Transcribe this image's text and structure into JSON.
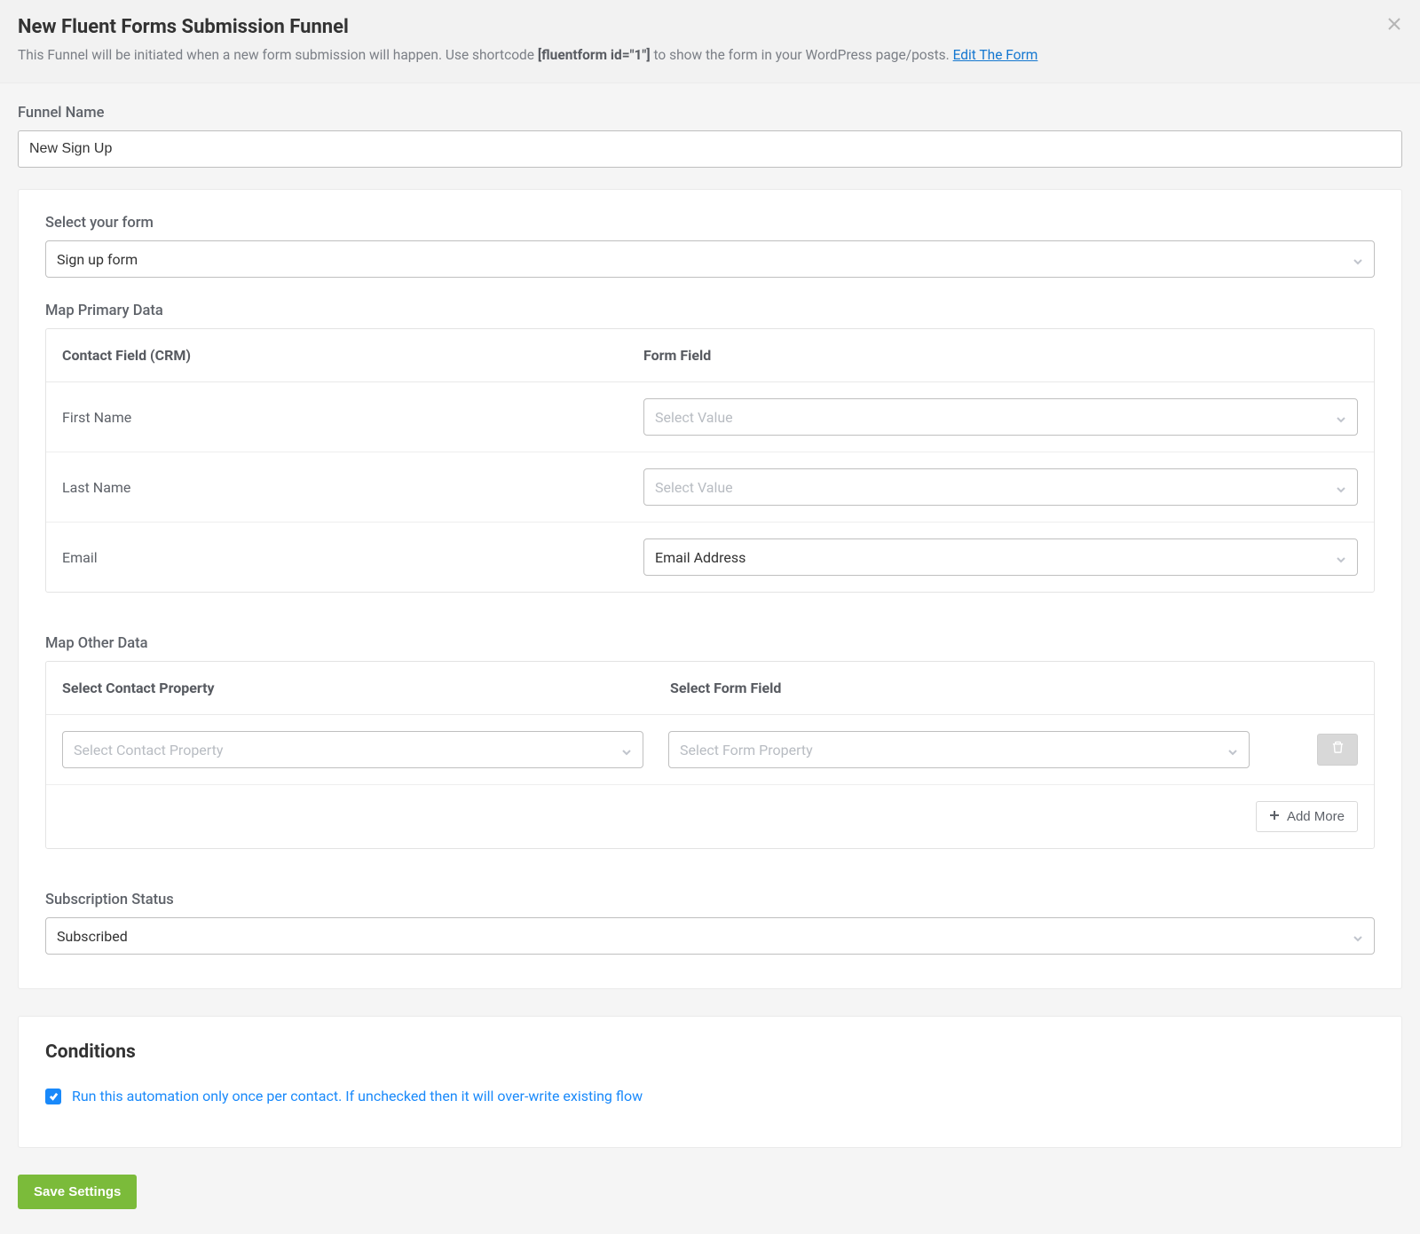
{
  "header": {
    "title": "New Fluent Forms Submission Funnel",
    "description_prefix": "This Funnel will be initiated when a new form submission will happen. Use shortcode ",
    "shortcode": "[fluentform id=\"1\"]",
    "description_suffix": " to show the form in your WordPress page/posts. ",
    "edit_link": "Edit The Form"
  },
  "funnel_name": {
    "label": "Funnel Name",
    "value": "New Sign Up"
  },
  "select_form": {
    "label": "Select your form",
    "value": "Sign up form"
  },
  "map_primary": {
    "label": "Map Primary Data",
    "col1": "Contact Field (CRM)",
    "col2": "Form Field",
    "rows": [
      {
        "crm": "First Name",
        "form_value": "",
        "placeholder": "Select Value"
      },
      {
        "crm": "Last Name",
        "form_value": "",
        "placeholder": "Select Value"
      },
      {
        "crm": "Email",
        "form_value": "Email Address",
        "placeholder": "Select Value"
      }
    ]
  },
  "map_other": {
    "label": "Map Other Data",
    "col1": "Select Contact Property",
    "col2": "Select Form Field",
    "rows": [
      {
        "contact_placeholder": "Select Contact Property",
        "form_placeholder": "Select Form Property"
      }
    ],
    "add_more": "Add More"
  },
  "subscription": {
    "label": "Subscription Status",
    "value": "Subscribed"
  },
  "conditions": {
    "title": "Conditions",
    "run_once_checked": true,
    "run_once_label": "Run this automation only once per contact. If unchecked then it will over-write existing flow"
  },
  "save_button": "Save Settings"
}
